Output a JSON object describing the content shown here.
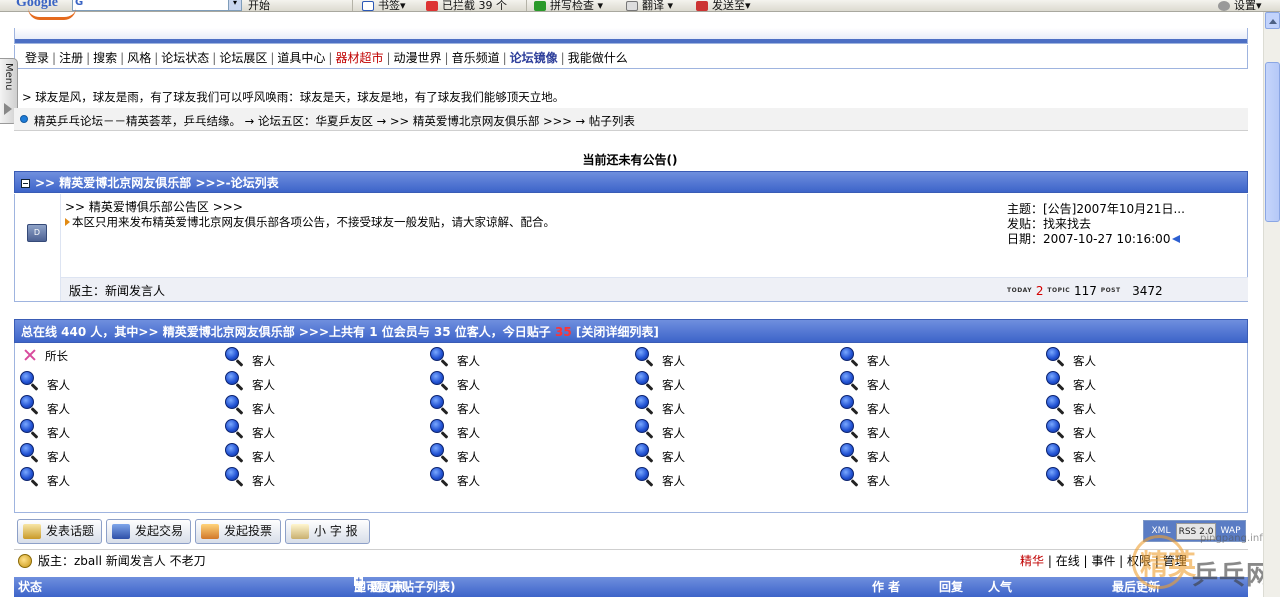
{
  "toolbar": {
    "search_value": "G",
    "items": [
      "开始",
      "书签▾",
      "已拦截 39 个",
      "拼写检查 ▾",
      "翻译 ▾",
      "发送至▾",
      "设置▾"
    ],
    "brand": "Google"
  },
  "menu_tab": "Menu",
  "nav": {
    "items": [
      "登录",
      "注册",
      "搜索",
      "风格",
      "论坛状态",
      "论坛展区",
      "道具中心",
      "器材超市",
      "动漫世界",
      "音乐频道",
      "论坛镜像",
      "我能做什么"
    ]
  },
  "motto": "> 球友是风，球友是雨，有了球友我们可以呼风唤雨：球友是天，球友是地，有了球友我们能够顶天立地。",
  "breadcrumb": "精英乒乓论坛－－精英荟萃，乒乓结缘。 → 论坛五区：华夏乒友区 → >> 精英爱博北京网友俱乐部 >>> → 帖子列表",
  "announcement": "当前还未有公告()",
  "forum_list": {
    "header": ">> 精英爱博北京网友俱乐部 >>>-论坛列表",
    "forum": {
      "icon_label": "D",
      "title": ">> 精英爱博俱乐部公告区 >>>",
      "description": "本区只用来发布精英爱博北京网友俱乐部各项公告，不接受球友一般发贴，请大家谅解、配合。",
      "latest_topic": "主题：[公告]2007年10月21日...",
      "latest_poster": "发贴：找来找去",
      "latest_date": "日期：2007-10-27 10:16:00",
      "moderators": "版主：新闻发言人",
      "today_tag": "TODAY",
      "today": "2",
      "topic_tag": "TOPIC",
      "topics": "117",
      "post_tag": "POST",
      "posts": "3472"
    }
  },
  "online": {
    "header_prefix": "总在线 440 人，其中>> 精英爱博北京网友俱乐部 >>>上共有 1 位会员与 35 位客人，今日贴子 ",
    "today_posts": "35",
    "header_suffix": " [关闭详细列表]",
    "host_name": "所长",
    "guest_name": "客人",
    "guest_count": 35
  },
  "actions": [
    "发表话题",
    "发起交易",
    "发起投票",
    "小 字 报"
  ],
  "feeds": [
    "XML",
    "RSS 2.0",
    "WAP"
  ],
  "modbar": {
    "text": "版主：zball 新闻发言人 不老刀",
    "tab_hot": "精华",
    "tabs_rest": " | 在线 | 事件 | 权限 | 管理"
  },
  "thread_header": {
    "status": "状态",
    "topic": "主 题 (点",
    "topic_hint": "即可展开贴子列表)",
    "author": "作 者",
    "replies": "回复",
    "views": "人气",
    "last": "最后更新"
  },
  "watermark": {
    "url": "pingpang.info",
    "char1": "精英",
    "char2": "乒乓网"
  }
}
